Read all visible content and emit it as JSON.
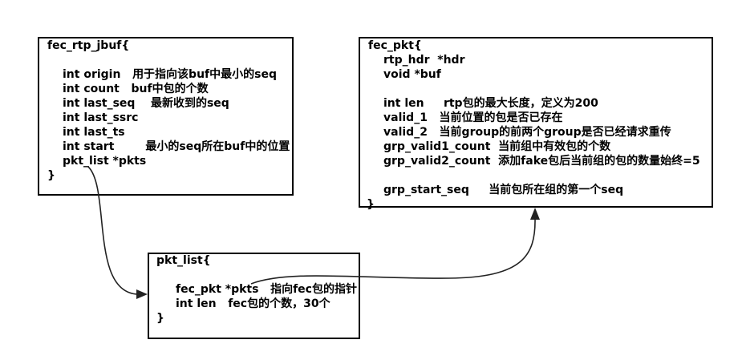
{
  "boxes": {
    "fec_rtp_jbuf": {
      "lines": [
        "fec_rtp_jbuf{",
        "",
        "int origin   用于指向该buf中最小的seq",
        "int count   buf中包的个数",
        "int last_seq    最新收到的seq",
        "int last_ssrc",
        "int last_ts",
        "int start        最小的seq所在buf中的位置",
        "pkt_list *pkts",
        "}"
      ]
    },
    "fec_pkt": {
      "lines": [
        "fec_pkt{",
        "rtp_hdr  *hdr",
        "void *buf",
        "",
        "int len     rtp包的最大长度，定义为200",
        "valid_1   当前位置的包是否已存在",
        "valid_2   当前group的前两个group是否已经请求重传",
        "grp_valid1_count  当前组中有效包的个数",
        "grp_valid2_count  添加fake包后当前组的包的数量始终=5",
        "",
        "grp_start_seq     当前包所在组的第一个seq",
        "}"
      ]
    },
    "pkt_list": {
      "lines": [
        "pkt_list{",
        "",
        "fec_pkt *pkts   指向fec包的指针",
        "int len   fec包的个数，30个",
        "}"
      ]
    }
  },
  "connectors": [
    {
      "from": "fec_rtp_jbuf.pkts",
      "to": "pkt_list"
    },
    {
      "from": "pkt_list.pkts",
      "to": "fec_pkt"
    }
  ]
}
